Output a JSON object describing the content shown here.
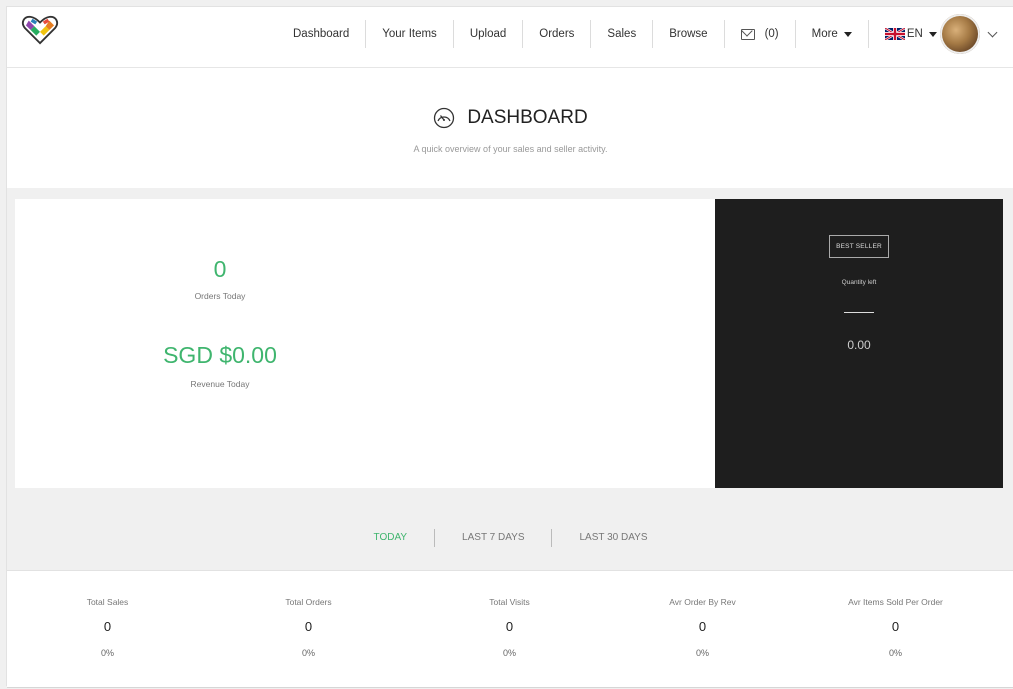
{
  "nav": {
    "items": [
      "Dashboard",
      "Your Items",
      "Upload",
      "Orders",
      "Sales",
      "Browse"
    ],
    "messages_count": "(0)",
    "more_label": "More",
    "language": "EN"
  },
  "header": {
    "title": "DASHBOARD",
    "subtitle": "A quick overview of your sales and seller activity."
  },
  "today": {
    "orders_value": "0",
    "orders_label": "Orders Today",
    "revenue_value": "SGD $0.00",
    "revenue_label": "Revenue Today"
  },
  "best_seller": {
    "badge": "BEST SELLER",
    "quantity_label": "Quantity left",
    "value": "0.00"
  },
  "tabs": [
    "TODAY",
    "LAST 7 DAYS",
    "LAST 30 DAYS"
  ],
  "active_tab": "TODAY",
  "metrics": [
    {
      "label": "Total Sales",
      "value": "0",
      "percent": "0%"
    },
    {
      "label": "Total Orders",
      "value": "0",
      "percent": "0%"
    },
    {
      "label": "Total Visits",
      "value": "0",
      "percent": "0%"
    },
    {
      "label": "Avr Order By Rev",
      "value": "0",
      "percent": "0%"
    },
    {
      "label": "Avr Items Sold Per Order",
      "value": "0",
      "percent": "0%"
    }
  ],
  "colors": {
    "accent": "#3fb56e",
    "dark_panel": "#1e1e1e",
    "band": "#f0f0f0"
  }
}
